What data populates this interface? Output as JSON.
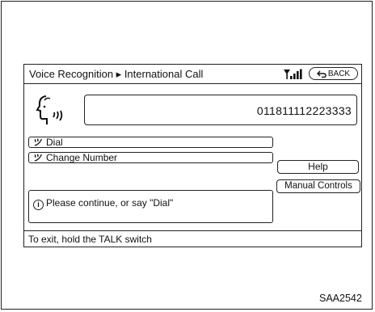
{
  "header": {
    "title": "Voice Recognition ▸ International Call",
    "back_label": "BACK"
  },
  "icons": {
    "signal": "signal-strength-icon",
    "back_arrow": "return-arrow-icon",
    "speaker": "voice-speaker-icon",
    "voice_command": "voice-command-icon",
    "info": "info-icon"
  },
  "entry": {
    "number": "011811112223333"
  },
  "commands": [
    {
      "symbol": "ツ",
      "label": "Dial"
    },
    {
      "symbol": "ツ",
      "label": "Change Number"
    }
  ],
  "side_buttons": {
    "help": "Help",
    "manual_controls": "Manual Controls"
  },
  "message": {
    "icon_glyph": "i",
    "text": "Please continue, or say \"Dial\""
  },
  "status": {
    "hint": "To exit, hold the TALK switch"
  },
  "figure_code": "SAA2542"
}
